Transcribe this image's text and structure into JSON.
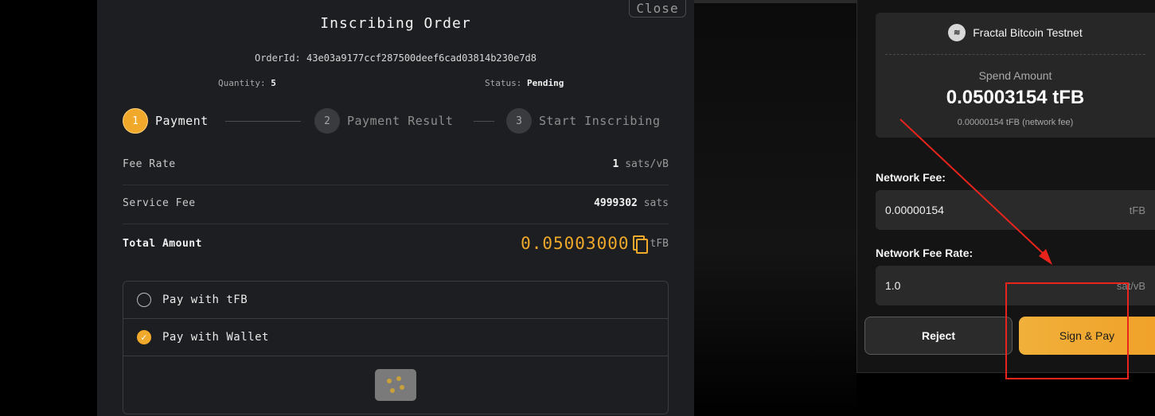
{
  "modal": {
    "close_label": "Close",
    "title": "Inscribing Order",
    "order_id_label": "OrderId:",
    "order_id": "43e03a9177ccf287500deef6cad03814b230e7d8",
    "quantity_label": "Quantity:",
    "quantity": "5",
    "status_label": "Status:",
    "status": "Pending",
    "steps": [
      {
        "num": "1",
        "label": "Payment",
        "state": "active"
      },
      {
        "num": "2",
        "label": "Payment Result",
        "state": "idle"
      },
      {
        "num": "3",
        "label": "Start Inscribing",
        "state": "idle"
      }
    ],
    "fee_rate": {
      "label": "Fee Rate",
      "value": "1",
      "unit": "sats/vB"
    },
    "service_fee": {
      "label": "Service Fee",
      "value": "4999302",
      "unit": "sats"
    },
    "total": {
      "label": "Total Amount",
      "value": "0.05003000",
      "unit": "tFB"
    },
    "pay_options": [
      {
        "label": "Pay with tFB",
        "selected": false
      },
      {
        "label": "Pay with Wallet",
        "selected": true
      }
    ]
  },
  "wallet": {
    "network": "Fractal Bitcoin Testnet",
    "spend_label": "Spend Amount",
    "spend_amount": "0.05003154 tFB",
    "spend_fee_note": "0.00000154 tFB (network fee)",
    "network_fee_label": "Network Fee:",
    "network_fee_value": "0.00000154",
    "network_fee_unit": "tFB",
    "network_fee_rate_label": "Network Fee Rate:",
    "network_fee_rate_value": "1.0",
    "network_fee_rate_unit": "sat/vB",
    "reject_label": "Reject",
    "sign_label": "Sign & Pay"
  },
  "colors": {
    "accent": "#f0a92a",
    "annotation": "#e8241c"
  }
}
